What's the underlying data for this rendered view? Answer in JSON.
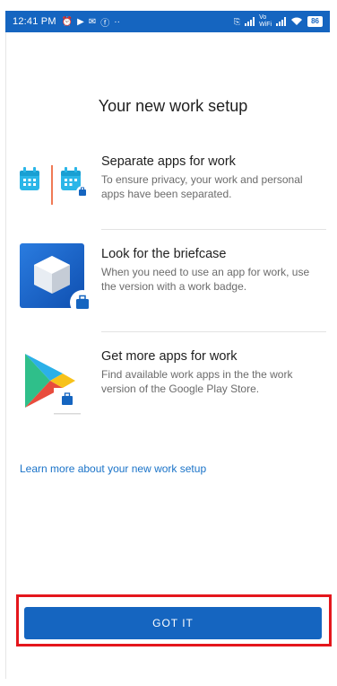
{
  "status_bar": {
    "time": "12:41 PM",
    "notif_icons": [
      "alarm-icon",
      "play-icon",
      "mail-icon",
      "facebook-icon",
      "more-icon"
    ],
    "lte_label": "Vo\nWiFi",
    "battery": "86"
  },
  "page": {
    "title": "Your new work setup",
    "items": [
      {
        "icon": "calendar-work-icon",
        "heading": "Separate apps for work",
        "description": "To ensure privacy, your work and personal apps have been separated."
      },
      {
        "icon": "briefcase-app-icon",
        "heading": "Look for the briefcase",
        "description": "When you need to use an app for work, use the version with a work badge."
      },
      {
        "icon": "play-store-work-icon",
        "heading": "Get more apps for work",
        "description": "Find available work apps in the the work version of the Google Play Store."
      }
    ],
    "learn_more_link": "Learn more about your new work setup",
    "got_it_button": "GOT IT"
  },
  "colors": {
    "primary": "#1565c0",
    "link": "#1a73c8",
    "highlight": "#e4161c"
  }
}
